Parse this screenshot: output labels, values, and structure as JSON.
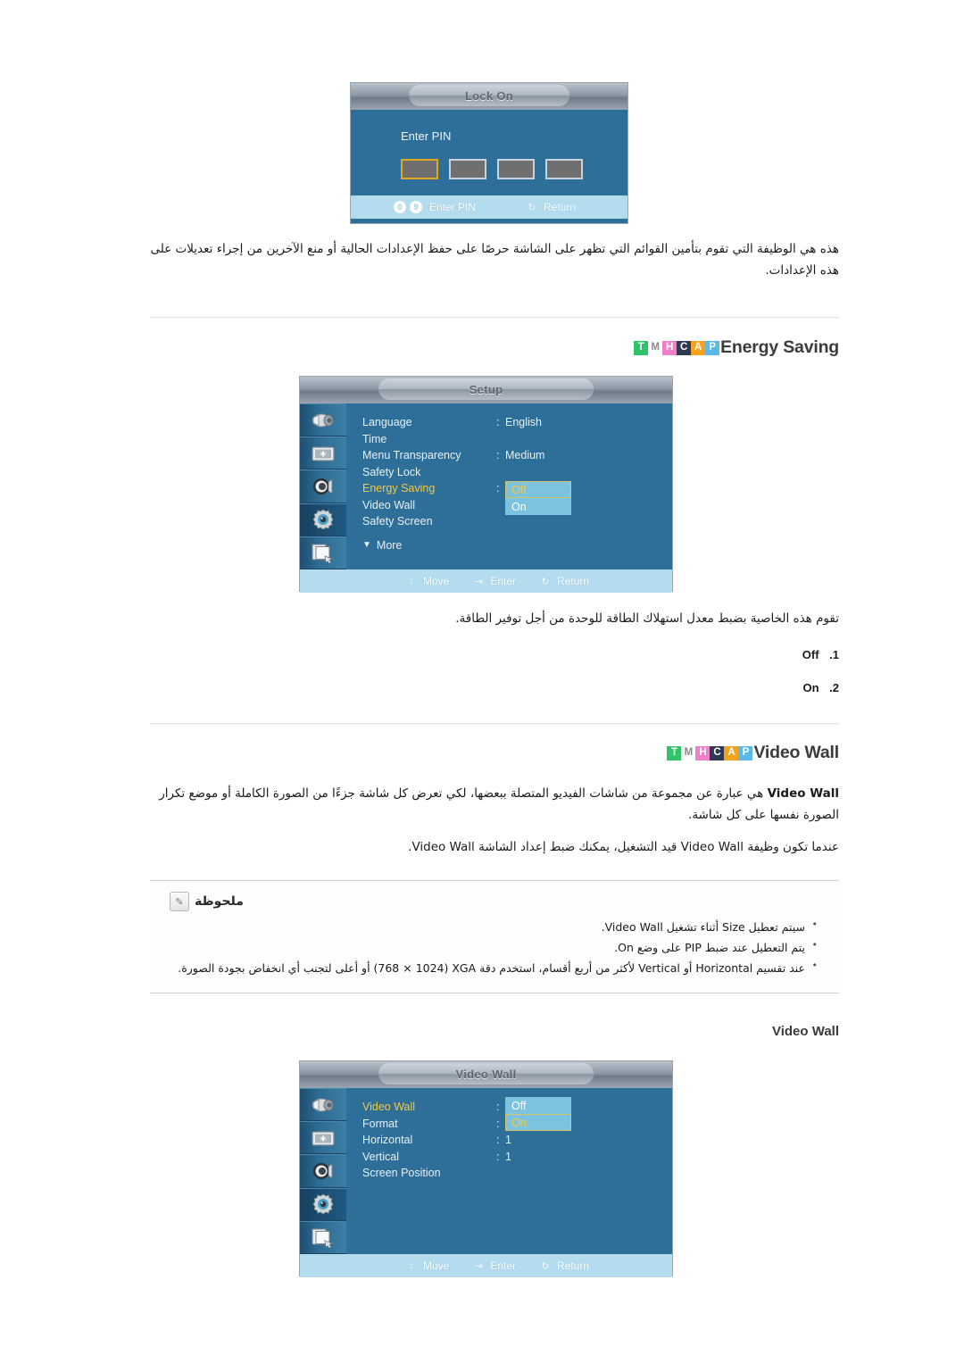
{
  "lock_dialog": {
    "title": "Lock On",
    "enter_pin_label": "Enter PIN",
    "pin_boxes": [
      "",
      "",
      "",
      ""
    ],
    "footer": {
      "badge_0": "0",
      "badge_9": "9",
      "enter_pin": "Enter PIN",
      "return": "Return"
    }
  },
  "lock_paragraph": "هذه هي الوظيفة التي تقوم بتأمين القوائم التي تظهر على الشاشة حرصًا على حفظ الإعدادات الحالية أو منع الآخرين من إجراء تعديلات على هذه الإعدادات.",
  "badges": {
    "letters": [
      "T",
      "M",
      "H",
      "C",
      "A",
      "P"
    ],
    "colors": [
      "#2fc36a",
      "#ffffff",
      "#ef7fc8",
      "#2f3a52",
      "#f5a21e",
      "#5bb8e8"
    ],
    "text_colors": [
      "#ffffff",
      "#8a8a8a",
      "#ffffff",
      "#ffffff",
      "#ffffff",
      "#ffffff"
    ]
  },
  "energy_saving": {
    "heading": "Energy Saving",
    "osd": {
      "title": "Setup",
      "rows": [
        {
          "label": "Language",
          "colon": ":",
          "value": "English",
          "highlight": false
        },
        {
          "label": "Time",
          "colon": "",
          "value": "",
          "highlight": false
        },
        {
          "label": "Menu Transparency",
          "colon": ":",
          "value": "Medium",
          "highlight": false
        },
        {
          "label": "Safety Lock",
          "colon": "",
          "value": "",
          "highlight": false
        },
        {
          "label": "Energy Saving",
          "colon": ":",
          "value": "",
          "highlight": true
        },
        {
          "label": "Video Wall",
          "colon": "",
          "value": "",
          "highlight": false
        },
        {
          "label": "Safety Screen",
          "colon": "",
          "value": "",
          "highlight": false
        }
      ],
      "more": "More",
      "dropdown": {
        "selected": "Off",
        "other": "On"
      },
      "footer": {
        "move": "Move",
        "enter": "Enter",
        "return": "Return"
      }
    },
    "description": "تقوم هذه الخاصية بضبط معدل استهلاك الطاقة للوحدة من أجل توفير الطاقة.",
    "options": [
      {
        "num": ".1",
        "label": "Off"
      },
      {
        "num": ".2",
        "label": "On"
      }
    ]
  },
  "video_wall": {
    "heading": "Video Wall",
    "paragraph_1_pre": "Video Wall",
    "paragraph_1": " هي عبارة عن مجموعة من شاشات الفيديو المتصلة ببعضها، لكي تعرض كل شاشة جزءًا من الصورة الكاملة أو موضع تكرار الصورة نفسها على كل شاشة.",
    "paragraph_2": "عندما تكون وظيفة Video Wall قيد التشغيل، يمكنك ضبط إعداد الشاشة Video Wall.",
    "note": {
      "title": "ملحوظة",
      "items": [
        "سيتم تعطيل Size أثناء تشغيل Video Wall.",
        "يتم التعطيل عند ضبط PIP على وضع On.",
        "عند تقسيم Horizontal أو Vertical لأكثر من أربع أقسام، استخدم دقة XGA ‏(1024 × 768) أو أعلى لتجنب أي انخفاض بجودة الصورة."
      ]
    },
    "sub_heading": "Video Wall",
    "osd": {
      "title": "Video Wall",
      "rows": [
        {
          "label": "Video Wall",
          "colon": ":",
          "value": "",
          "highlight": true
        },
        {
          "label": "Format",
          "colon": ":",
          "value": "",
          "highlight": false
        },
        {
          "label": "Horizontal",
          "colon": ":",
          "value": "1",
          "highlight": false
        },
        {
          "label": "Vertical",
          "colon": ":",
          "value": "1",
          "highlight": false
        },
        {
          "label": "Screen Position",
          "colon": "",
          "value": "",
          "highlight": false
        }
      ],
      "dropdown": {
        "top": "Off",
        "selected": "On"
      },
      "footer": {
        "move": "Move",
        "enter": "Enter",
        "return": "Return"
      }
    }
  },
  "icons": {
    "rail": [
      "input-source-icon",
      "picture-icon",
      "sound-icon",
      "setup-gear-icon",
      "multi-control-icon"
    ],
    "move": "up-down-arrow-icon",
    "enter": "enter-arrow-icon",
    "return": "return-arrow-icon",
    "caret": "caret-down-icon",
    "note": "note-pencil-icon"
  }
}
